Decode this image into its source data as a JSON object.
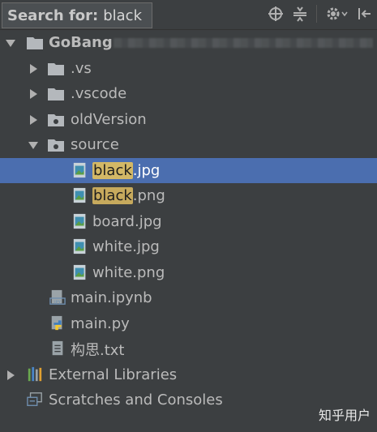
{
  "search": {
    "label": "Search for:",
    "query": "black"
  },
  "toolbar": {
    "icons": [
      "target-icon",
      "collapse-icon",
      "gear-icon",
      "hide-panel-icon"
    ]
  },
  "tree": {
    "project": "GoBang",
    "items": [
      {
        "label": ".vs"
      },
      {
        "label": ".vscode"
      },
      {
        "label": "oldVersion"
      },
      {
        "label": "source"
      },
      {
        "match": "black",
        "rest": ".jpg"
      },
      {
        "match": "black",
        "rest": ".png"
      },
      {
        "label": "board.jpg"
      },
      {
        "label": "white.jpg"
      },
      {
        "label": "white.png"
      },
      {
        "label": "main.ipynb"
      },
      {
        "label": "main.py"
      },
      {
        "label": "构思.txt"
      },
      {
        "label": "External Libraries"
      },
      {
        "label": "Scratches and Consoles"
      }
    ]
  },
  "watermark": "知乎用户",
  "colors": {
    "background": "#3c3f41",
    "selection": "#4b6eaf",
    "match_highlight": "#c7aa5d"
  }
}
